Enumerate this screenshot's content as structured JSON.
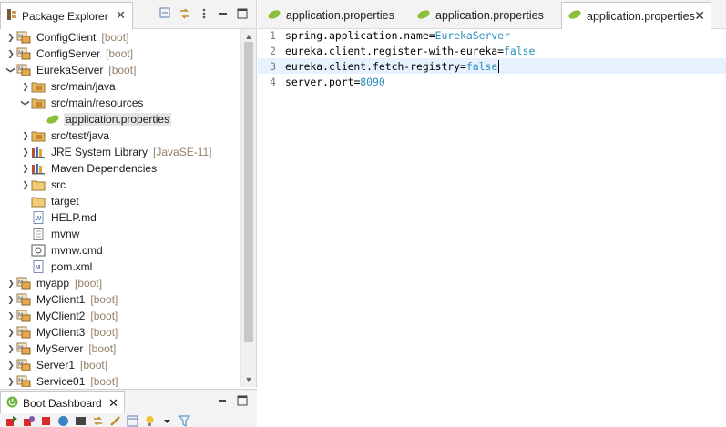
{
  "explorer": {
    "title": "Package Explorer",
    "close": "✕",
    "tree": [
      {
        "indent": 0,
        "arrow": "right",
        "icon": "project-icon",
        "label": "ConfigClient",
        "deco": "[boot]"
      },
      {
        "indent": 0,
        "arrow": "right",
        "icon": "project-icon",
        "label": "ConfigServer",
        "deco": "[boot]"
      },
      {
        "indent": 0,
        "arrow": "down",
        "icon": "project-icon",
        "label": "EurekaServer",
        "deco": "[boot]"
      },
      {
        "indent": 1,
        "arrow": "right",
        "icon": "source-folder-icon",
        "label": "src/main/java",
        "deco": ""
      },
      {
        "indent": 1,
        "arrow": "down",
        "icon": "source-folder-icon",
        "label": "src/main/resources",
        "deco": ""
      },
      {
        "indent": 2,
        "arrow": "none",
        "icon": "properties-file-icon",
        "label": "application.properties",
        "deco": "",
        "selected": true
      },
      {
        "indent": 1,
        "arrow": "right",
        "icon": "source-folder-icon",
        "label": "src/test/java",
        "deco": ""
      },
      {
        "indent": 1,
        "arrow": "right",
        "icon": "library-icon",
        "label": "JRE System Library",
        "deco": "[JavaSE-11]"
      },
      {
        "indent": 1,
        "arrow": "right",
        "icon": "library-icon",
        "label": "Maven Dependencies",
        "deco": ""
      },
      {
        "indent": 1,
        "arrow": "right",
        "icon": "folder-icon",
        "label": "src",
        "deco": ""
      },
      {
        "indent": 1,
        "arrow": "none",
        "icon": "folder-icon",
        "label": "target",
        "deco": ""
      },
      {
        "indent": 1,
        "arrow": "none",
        "icon": "markdown-file-icon",
        "label": "HELP.md",
        "deco": ""
      },
      {
        "indent": 1,
        "arrow": "none",
        "icon": "text-file-icon",
        "label": "mvnw",
        "deco": ""
      },
      {
        "indent": 1,
        "arrow": "none",
        "icon": "cmd-file-icon",
        "label": "mvnw.cmd",
        "deco": ""
      },
      {
        "indent": 1,
        "arrow": "none",
        "icon": "maven-pom-icon",
        "label": "pom.xml",
        "deco": ""
      },
      {
        "indent": 0,
        "arrow": "right",
        "icon": "project-icon",
        "label": "myapp",
        "deco": "[boot]"
      },
      {
        "indent": 0,
        "arrow": "right",
        "icon": "project-icon",
        "label": "MyClient1",
        "deco": "[boot]"
      },
      {
        "indent": 0,
        "arrow": "right",
        "icon": "project-icon",
        "label": "MyClient2",
        "deco": "[boot]"
      },
      {
        "indent": 0,
        "arrow": "right",
        "icon": "project-icon",
        "label": "MyClient3",
        "deco": "[boot]"
      },
      {
        "indent": 0,
        "arrow": "right",
        "icon": "project-icon",
        "label": "MyServer",
        "deco": "[boot]"
      },
      {
        "indent": 0,
        "arrow": "right",
        "icon": "project-icon",
        "label": "Server1",
        "deco": "[boot]"
      },
      {
        "indent": 0,
        "arrow": "right",
        "icon": "project-icon",
        "label": "Service01",
        "deco": "[boot]"
      }
    ]
  },
  "boot_dashboard": {
    "title": "Boot Dashboard",
    "close": "✕"
  },
  "editor": {
    "tabs": [
      {
        "label": "application.properties",
        "active": false
      },
      {
        "label": "application.properties",
        "active": false
      },
      {
        "label": "application.properties",
        "active": true,
        "close": "✕"
      }
    ],
    "lines": [
      {
        "num": "1",
        "key": "spring.application.name",
        "eq": "=",
        "value": "EurekaServer"
      },
      {
        "num": "2",
        "key": "eureka.client.register-with-eureka",
        "eq": "=",
        "value": "false"
      },
      {
        "num": "3",
        "key": "eureka.client.fetch-registry",
        "eq": "=",
        "value": "false",
        "current": true
      },
      {
        "num": "4",
        "key": "server.port",
        "eq": "=",
        "value": "8090"
      }
    ]
  },
  "colors": {
    "boot_decoration": "#95806a",
    "property_value": "#2a8fbf",
    "current_line": "#e8f2fe"
  }
}
